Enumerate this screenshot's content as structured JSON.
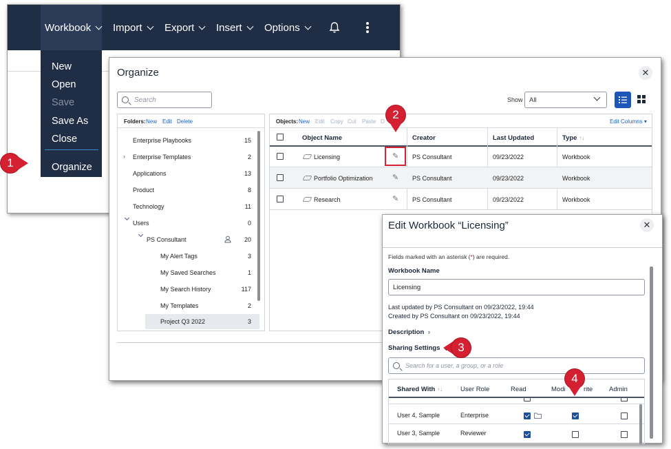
{
  "menu_window": {
    "nav": [
      {
        "label": "Workbook"
      },
      {
        "label": "Import"
      },
      {
        "label": "Export"
      },
      {
        "label": "Insert"
      },
      {
        "label": "Options"
      }
    ],
    "bell_icon": "bell-icon",
    "more_icon": "vertical-ellipsis-icon",
    "workbook_menu": [
      "New",
      "Open",
      "Save",
      "Save As",
      "Close",
      "Organize"
    ]
  },
  "callouts": [
    "1",
    "2",
    "3",
    "4"
  ],
  "organize": {
    "title": "Organize",
    "search_placeholder": "Search",
    "show_label": "Show",
    "show_value": "All",
    "folders": {
      "label": "Folders:",
      "actions": [
        "New",
        "Edit",
        "Delete"
      ],
      "items": [
        {
          "name": "Enterprise Playbooks",
          "count": "15"
        },
        {
          "name": "Enterprise Templates",
          "count": "2"
        },
        {
          "name": "Applications",
          "count": "13"
        },
        {
          "name": "Product",
          "count": "8"
        },
        {
          "name": "Technology",
          "count": "11"
        },
        {
          "name": "Users",
          "count": "0"
        },
        {
          "name": "PS Consultant",
          "count": "20"
        },
        {
          "name": "My Alert Tags",
          "count": "3"
        },
        {
          "name": "My Saved Searches",
          "count": "1"
        },
        {
          "name": "My Search History",
          "count": "117"
        },
        {
          "name": "My Templates",
          "count": "2"
        },
        {
          "name": "Project Q3 2022",
          "count": "3"
        }
      ]
    },
    "objects": {
      "label": "Objects:",
      "actions": [
        "New",
        "Edit",
        "Copy",
        "Cut",
        "Paste",
        "D"
      ],
      "edit_columns": "Edit Columns",
      "columns": [
        "Object Name",
        "Creator",
        "Last Updated",
        "Type"
      ],
      "rows": [
        {
          "name": "Licensing",
          "creator": "PS Consultant",
          "updated": "09/23/2022",
          "type": "Workbook"
        },
        {
          "name": "Portfolio Optimization",
          "creator": "PS Consultant",
          "updated": "09/23/2022",
          "type": "Workbook"
        },
        {
          "name": "Research",
          "creator": "PS Consultant",
          "updated": "09/23/2022",
          "type": "Workbook"
        }
      ]
    }
  },
  "edit_workbook": {
    "title": "Edit Workbook “Licensing”",
    "required_note_pre": "Fields marked with an asterisk (",
    "required_note_star": "*",
    "required_note_post": ") are required.",
    "name_label": "Workbook Name",
    "name_value": "Licensing",
    "last_updated": "Last updated by PS Consultant on 09/23/2022, 19:44",
    "created": "Created by PS Consultant on 09/23/2022, 19:44",
    "description": "Description",
    "sharing": "Sharing Settings",
    "sharing_search_placeholder": "Search for a user, a group, or a role",
    "share_columns": [
      "Shared With",
      "User Role",
      "Read",
      "Modify/Write",
      "Admin"
    ],
    "share_columns_visible": [
      "Shared With",
      "User Role",
      "Read",
      "Modi",
      "rite",
      "Admin"
    ],
    "share_rows": [
      {
        "user": "User 4, Sample",
        "role": "Enterprise",
        "read": true,
        "modify": true,
        "admin": false
      },
      {
        "user": "User 3, Sample",
        "role": "Reviewer",
        "read": true,
        "modify": false,
        "admin": false
      }
    ]
  }
}
